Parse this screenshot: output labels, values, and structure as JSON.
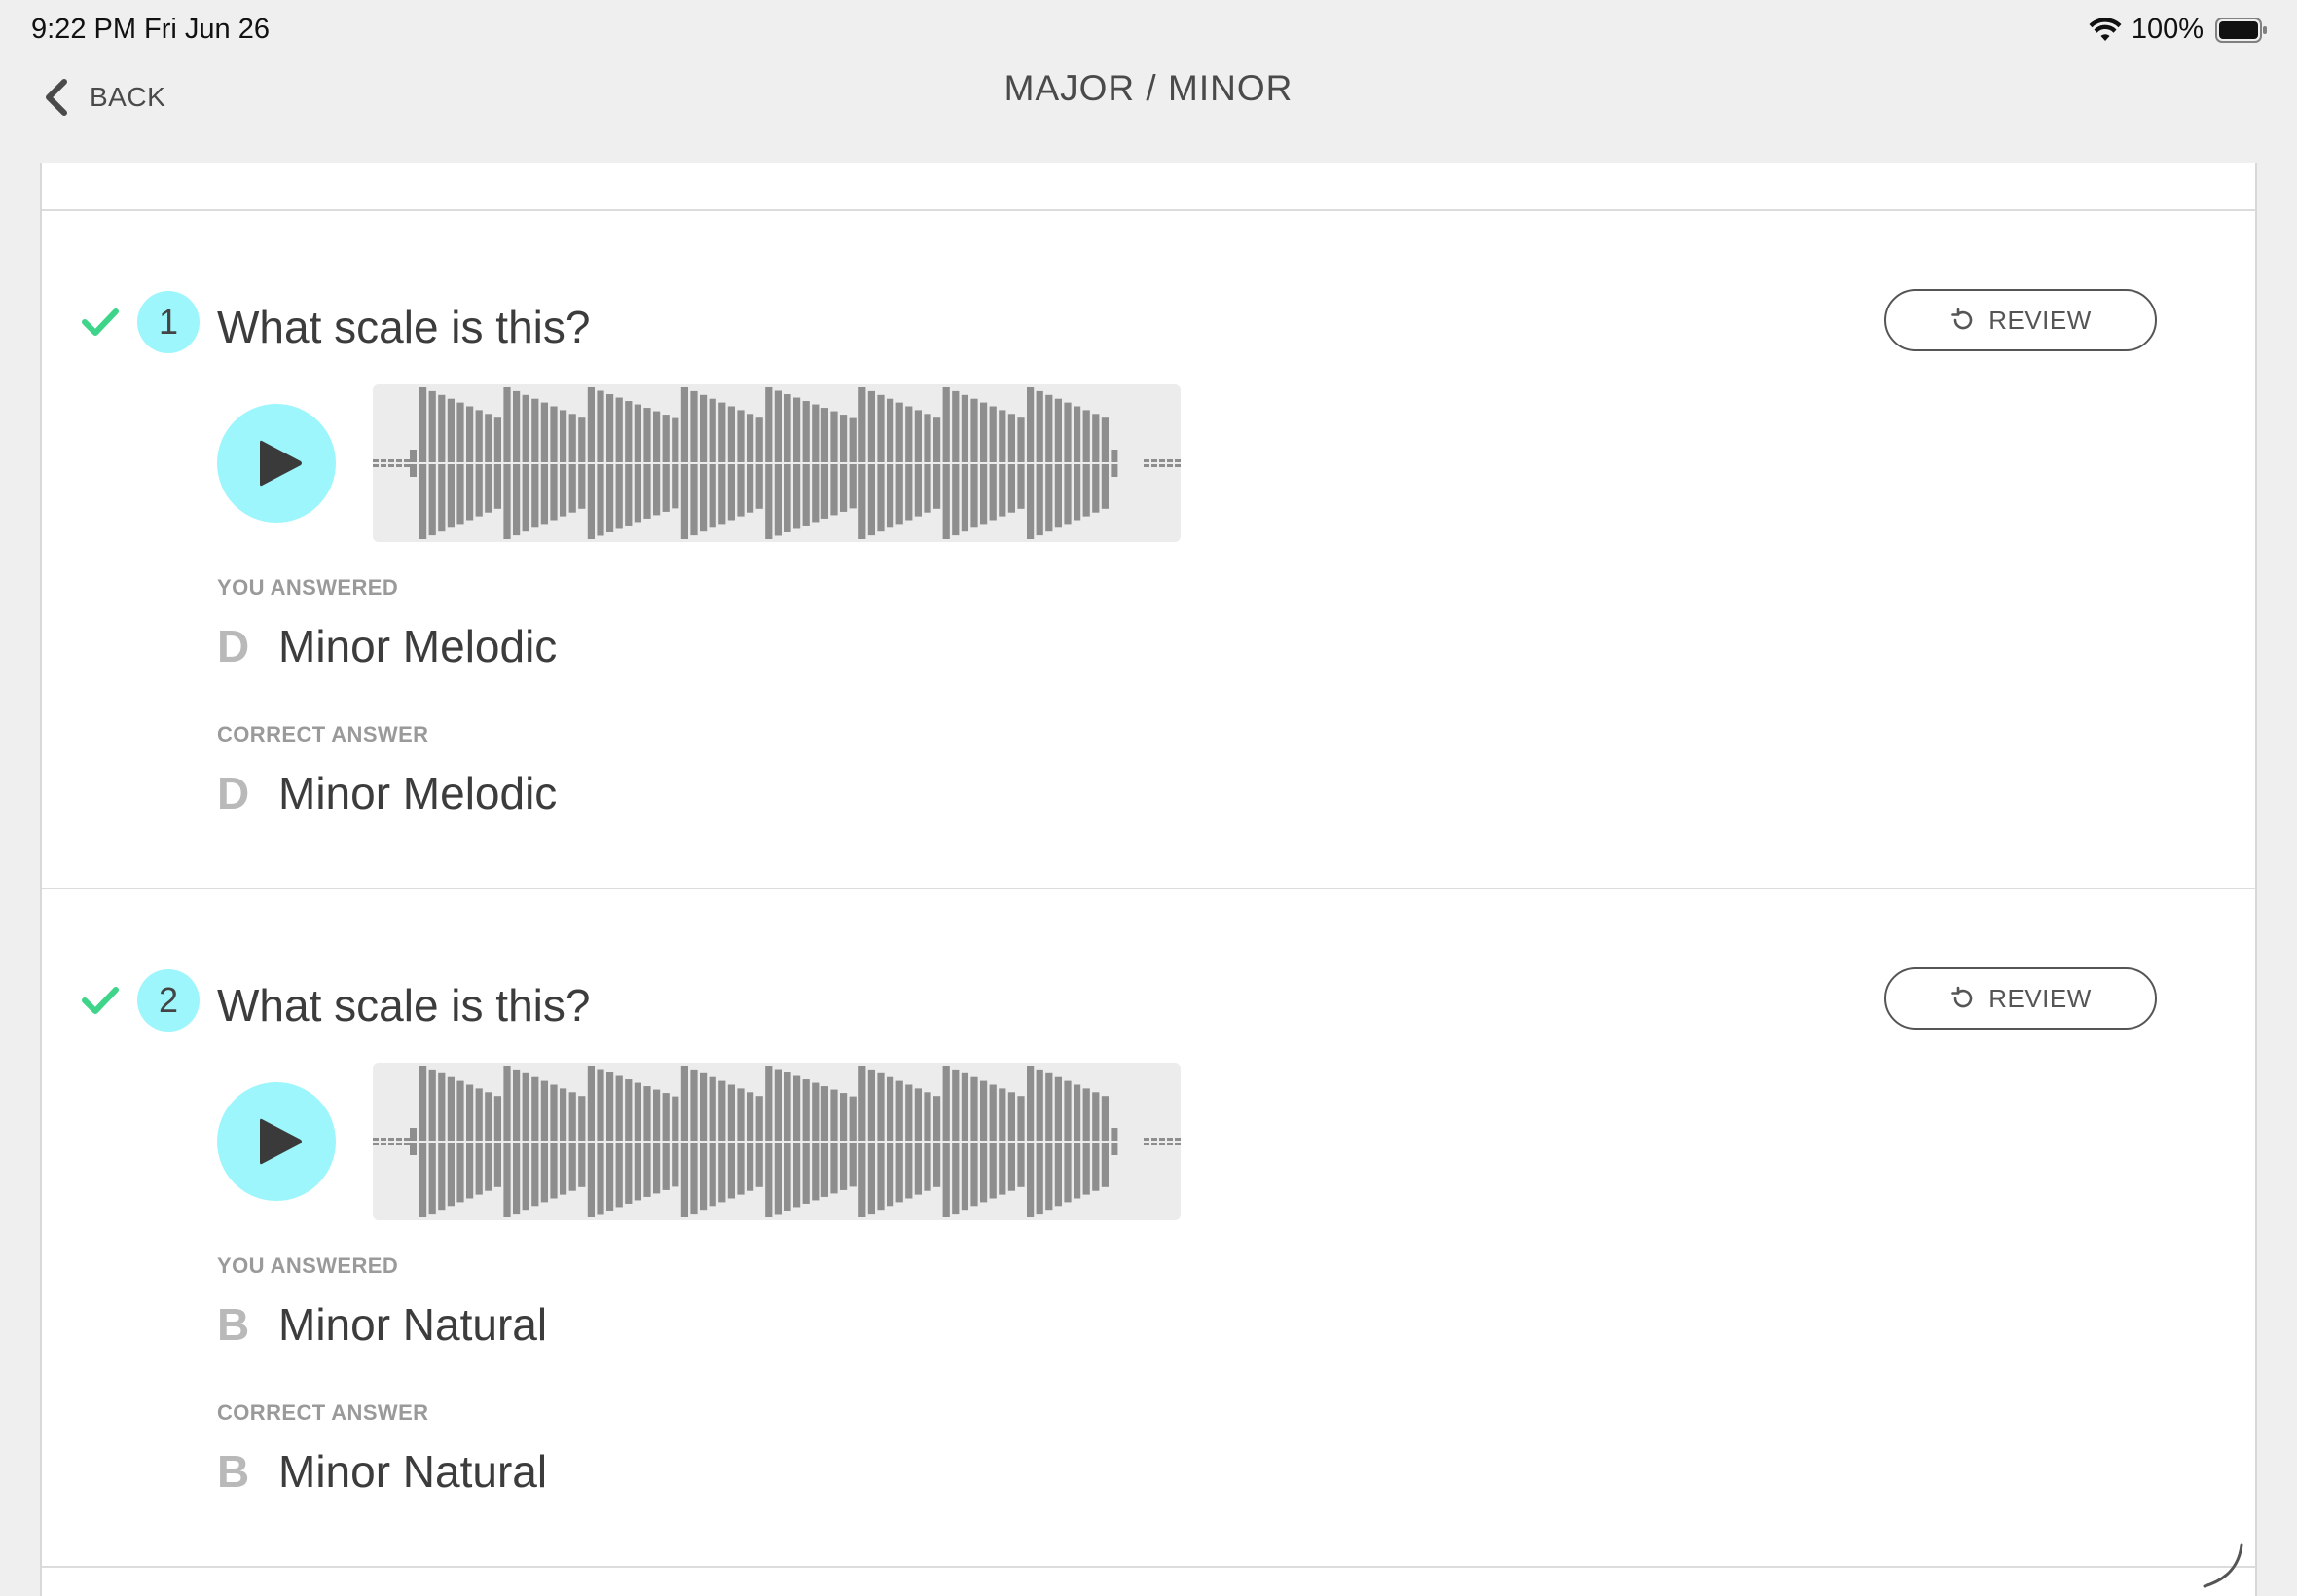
{
  "status_bar": {
    "time": "9:22 PM   Fri Jun 26",
    "battery": "100%"
  },
  "nav": {
    "back_label": "BACK",
    "title": "MAJOR / MINOR"
  },
  "labels": {
    "you_answered": "YOU ANSWERED",
    "correct_answer": "CORRECT ANSWER",
    "review": "REVIEW"
  },
  "questions": [
    {
      "number": "1",
      "text": "What scale is this?",
      "correct": true,
      "you_answered": {
        "letter": "D",
        "text": "Minor Melodic"
      },
      "correct_answer": {
        "letter": "D",
        "text": "Minor Melodic"
      }
    },
    {
      "number": "2",
      "text": "What scale is this?",
      "correct": true,
      "you_answered": {
        "letter": "B",
        "text": "Minor Natural"
      },
      "correct_answer": {
        "letter": "B",
        "text": "Minor Natural"
      }
    }
  ],
  "icons": {
    "check": "check-icon",
    "play": "play-icon",
    "review": "rotate-ccw-icon",
    "back": "chevron-left-icon"
  },
  "colors": {
    "accent": "#9df6fc",
    "check": "#3ed58a",
    "waveform_bar": "#8e8e8e"
  }
}
